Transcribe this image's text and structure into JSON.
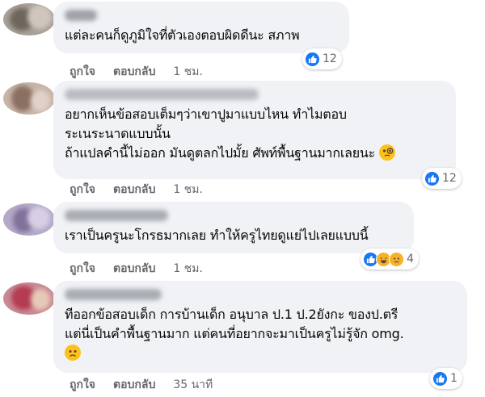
{
  "comments": [
    {
      "text_lines": [
        "แต่ละคนก็ดูภูมิใจที่ตัวเองตอบผิดดีนะ สภาพ"
      ],
      "actions": {
        "like": "ถูกใจ",
        "reply": "ตอบกลับ",
        "time": "1 ชม."
      },
      "reactions": {
        "icons": [
          "like-icon"
        ],
        "count": "12"
      }
    },
    {
      "text_lines": [
        "อยากเห็นข้อสอบเต็มๆว่าเขาปูมาแบบไหน ทำไมตอบ",
        "ระเนระนาดแบบนั้น",
        "ถ้าแปลคำนี้ไม่ออก มันดูตลกไปมั้ย ศัพท์พื้นฐานมากเลยนะ"
      ],
      "emoji": "monocle-face-emoji",
      "actions": {
        "like": "ถูกใจ",
        "reply": "ตอบกลับ",
        "time": "1 ชม."
      },
      "reactions": {
        "icons": [
          "like-icon"
        ],
        "count": "12"
      }
    },
    {
      "text_lines": [
        "เราเป็นครูนะโกรธมากเลย ทำให้ครูไทยดูแย่ไปเลยแบบนี้"
      ],
      "actions": {
        "like": "ถูกใจ",
        "reply": "ตอบกลับ",
        "time": "1 ชม."
      },
      "reactions": {
        "icons": [
          "like-icon",
          "haha-icon",
          "sad-icon"
        ],
        "count": "4"
      }
    },
    {
      "text_lines": [
        "ทีออกข้อสอบเด็ก การบ้านเด็ก อนุบาล ป.1 ป.2ยังกะ ของป.ตรี",
        "แต่นี่เป็นคำพื้นฐานมาก แต่คนที่อยากจะมาเป็นครูไม่รู้จัก omg."
      ],
      "emoji": "frowning-face-emoji",
      "actions": {
        "like": "ถูกใจ",
        "reply": "ตอบกลับ",
        "time": "35 นาที"
      },
      "reactions": {
        "icons": [
          "like-icon"
        ],
        "count": "1"
      }
    }
  ],
  "colors": {
    "bubble": "#f0f2f5",
    "like": "#1877f2",
    "meta": "#65676b"
  }
}
